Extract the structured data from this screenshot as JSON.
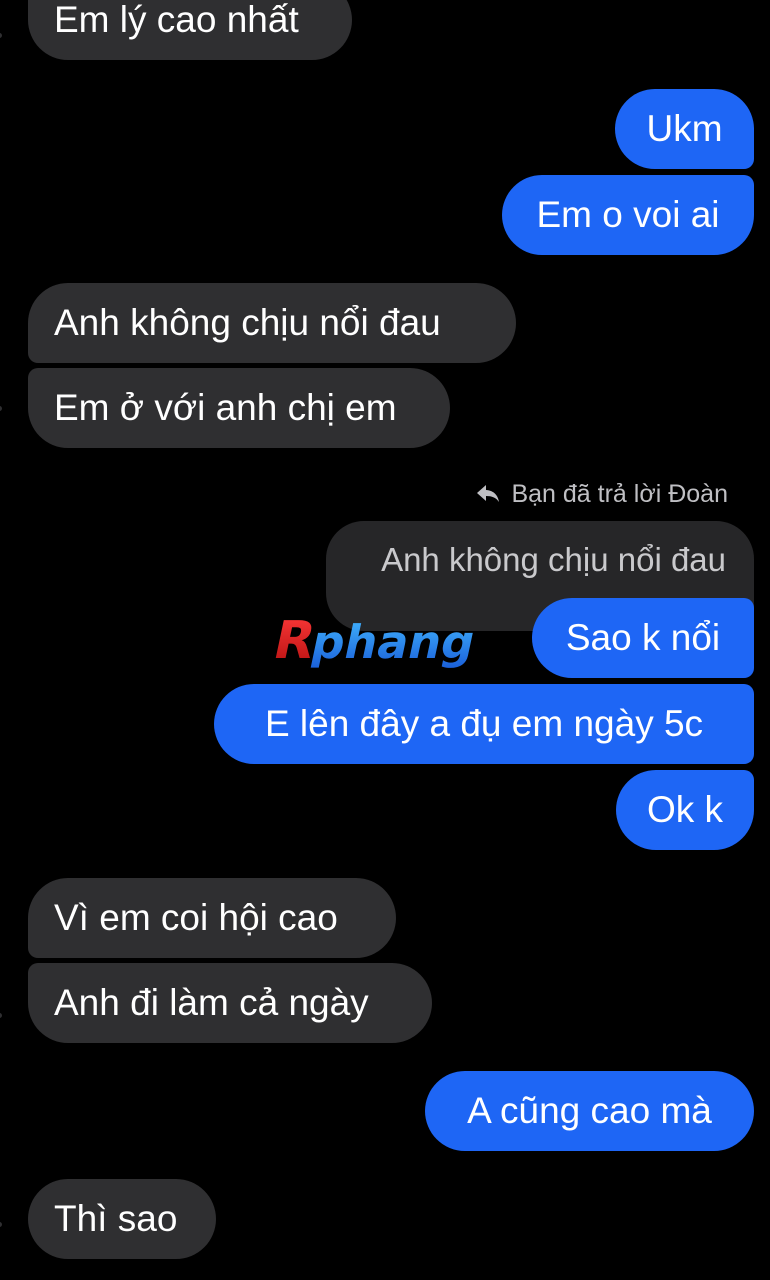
{
  "chat": {
    "messages": [
      {
        "side": "in",
        "text": "Em lý cao nhất"
      },
      {
        "side": "out",
        "text": "Ukm"
      },
      {
        "side": "out",
        "text": "Em o voi ai"
      },
      {
        "side": "in",
        "text": "Anh không chịu nổi đau"
      },
      {
        "side": "in",
        "text": "Em ở với anh chị em"
      },
      {
        "side": "out",
        "text": "Sao k nổi"
      },
      {
        "side": "out",
        "text": "E lên đây a đụ em ngày 5c"
      },
      {
        "side": "out",
        "text": "Ok k"
      },
      {
        "side": "in",
        "text": "Vì em coi hội cao"
      },
      {
        "side": "in",
        "text": "Anh đi làm cả ngày"
      },
      {
        "side": "out",
        "text": "A cũng cao mà"
      },
      {
        "side": "in",
        "text": "Thì sao"
      }
    ],
    "reply": {
      "meta": "Bạn đã trả lời Đoàn",
      "quoted": "Anh không chịu nổi đau",
      "icon": "reply-arrow-icon"
    },
    "watermark": "Rphang"
  },
  "colors": {
    "background": "#000000",
    "incoming_bubble": "#2f2f31",
    "outgoing_bubble": "#1e66f5",
    "quote_bubble": "#262628"
  }
}
